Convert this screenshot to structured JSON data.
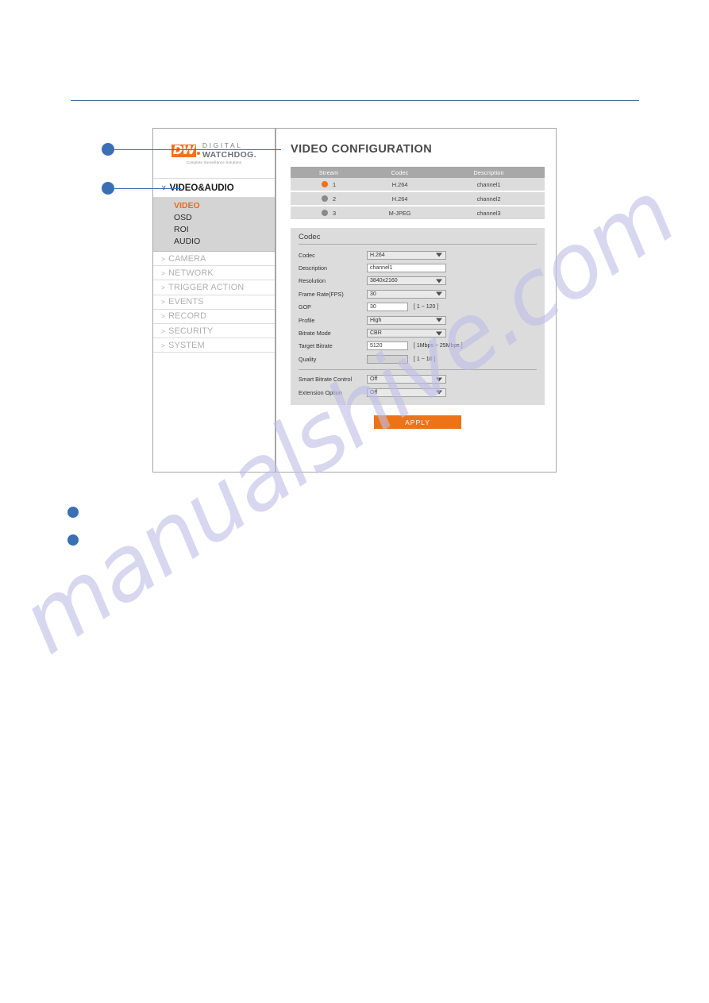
{
  "watermark": {
    "text": "manualshive.com"
  },
  "device": {
    "nav": {
      "logo": {
        "mark": "DW",
        "line1": "DIGITAL",
        "line2": "WATCHDOG.",
        "tagline": "Complete Surveillance Solutions"
      },
      "group": {
        "caret": "∨",
        "label": "VIDEO&AUDIO",
        "sub_items": [
          {
            "label": "VIDEO",
            "active": true
          },
          {
            "label": "OSD",
            "active": false
          },
          {
            "label": "ROI",
            "active": false
          },
          {
            "label": "AUDIO",
            "active": false
          }
        ]
      },
      "items": [
        {
          "caret": ">",
          "label": "CAMERA"
        },
        {
          "caret": ">",
          "label": "NETWORK"
        },
        {
          "caret": ">",
          "label": "TRIGGER ACTION"
        },
        {
          "caret": ">",
          "label": "EVENTS"
        },
        {
          "caret": ">",
          "label": "RECORD"
        },
        {
          "caret": ">",
          "label": "SECURITY"
        },
        {
          "caret": ">",
          "label": "SYSTEM"
        }
      ]
    },
    "content": {
      "title": "VIDEO CONFIGURATION",
      "stream_table": {
        "headers": [
          "Stream",
          "Codec",
          "Description"
        ],
        "rows": [
          {
            "stream": "1",
            "codec": "H.264",
            "description": "channel1",
            "selected": true
          },
          {
            "stream": "2",
            "codec": "H.264",
            "description": "channel2",
            "selected": false
          },
          {
            "stream": "3",
            "codec": "M-JPEG",
            "description": "channel3",
            "selected": false
          }
        ]
      },
      "codec_section": {
        "heading": "Codec",
        "fields": [
          {
            "label": "Codec",
            "value": "H.264",
            "type": "select"
          },
          {
            "label": "Description",
            "value": "channel1",
            "type": "text"
          },
          {
            "label": "Resolution",
            "value": "3840x2160",
            "type": "select"
          },
          {
            "label": "Frame Rate(FPS)",
            "value": "30",
            "type": "select"
          },
          {
            "label": "GOP",
            "value": "30",
            "type": "text-narrow",
            "hint": "[ 1 ~ 120 ]"
          },
          {
            "label": "Profile",
            "value": "High",
            "type": "select"
          },
          {
            "label": "Bitrate Mode",
            "value": "CBR",
            "type": "select"
          },
          {
            "label": "Target Bitrate",
            "value": "5120",
            "type": "text-narrow",
            "hint": "[ 1Mbps ~ 25Mbps ]"
          },
          {
            "label": "Quality",
            "value": "",
            "type": "text-narrow-disabled",
            "hint": "[ 1 ~ 10 ]"
          }
        ],
        "extra_fields": [
          {
            "label": "Smart Bitrate Control",
            "value": "Off",
            "type": "select"
          },
          {
            "label": "Extension Option",
            "value": "Off",
            "type": "select"
          }
        ]
      },
      "apply_label": "APPLY"
    }
  },
  "colors": {
    "accent_orange": "#ee7316",
    "callout_blue": "#3a6fb5",
    "panel_gray": "#dcdcdc",
    "header_gray": "#a8a8a8"
  }
}
